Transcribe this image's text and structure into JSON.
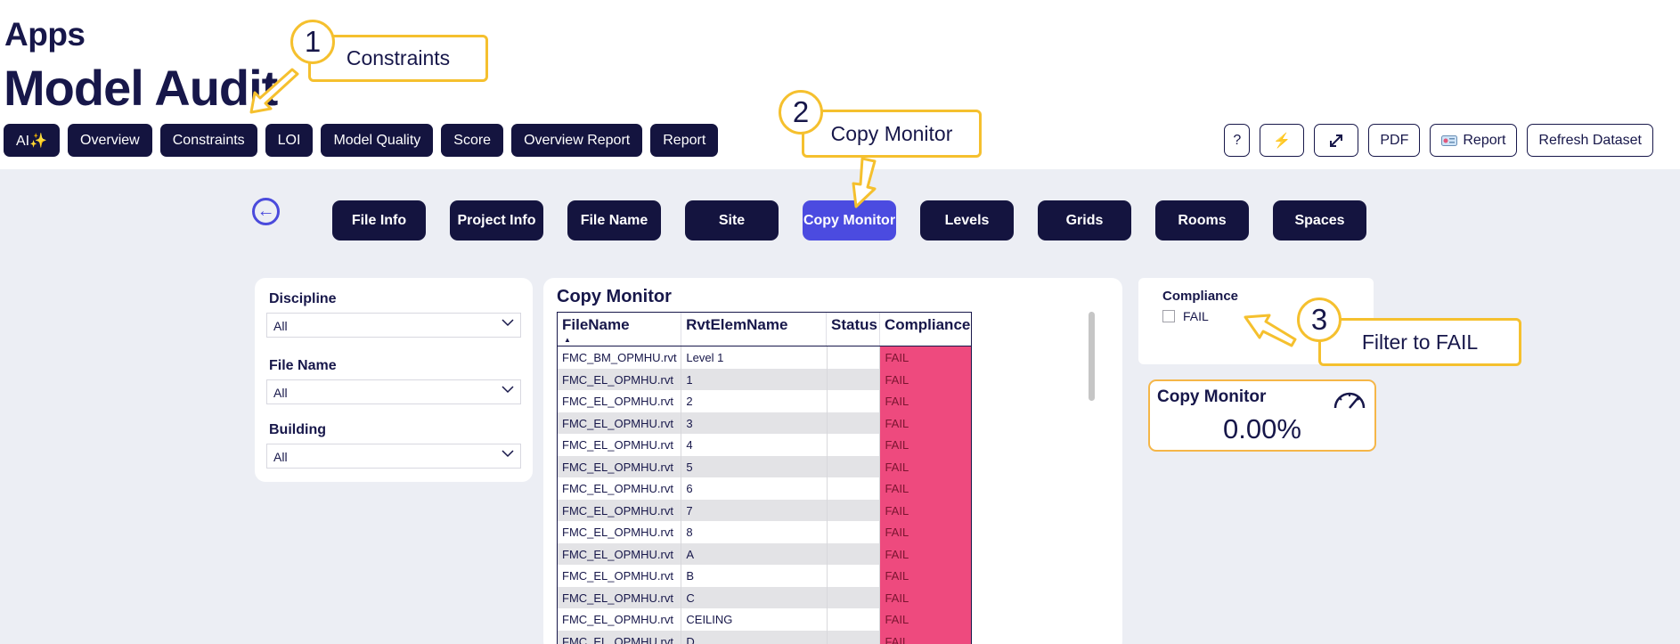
{
  "header": {
    "apps_label": "Apps",
    "page_title": "Model Audit"
  },
  "nav": {
    "items": [
      "AI✨",
      "Overview",
      "Constraints",
      "LOI",
      "Model Quality",
      "Score",
      "Overview Report",
      "Report"
    ]
  },
  "toolbar": {
    "help_label": "?",
    "bolt_icon": "lightning-icon",
    "expand_icon": "expand-icon",
    "pdf_label": "PDF",
    "report_label": "Report",
    "report_icon": "report-card-icon",
    "refresh_label": "Refresh Dataset"
  },
  "sub_nav": {
    "items": [
      "File Info",
      "Project Info",
      "File Name",
      "Site",
      "Copy Monitor",
      "Levels",
      "Grids",
      "Rooms",
      "Spaces"
    ],
    "active": "Copy Monitor"
  },
  "filters": {
    "discipline": {
      "label": "Discipline",
      "value": "All"
    },
    "file_name": {
      "label": "File Name",
      "value": "All"
    },
    "building": {
      "label": "Building",
      "value": "All"
    }
  },
  "table": {
    "title": "Copy Monitor",
    "columns": [
      "FileName",
      "RvtElemName",
      "Status",
      "Compliance"
    ],
    "rows": [
      [
        "FMC_BM_OPMHU.rvt",
        "Level 1",
        "",
        "FAIL"
      ],
      [
        "FMC_EL_OPMHU.rvt",
        "1",
        "",
        "FAIL"
      ],
      [
        "FMC_EL_OPMHU.rvt",
        "2",
        "",
        "FAIL"
      ],
      [
        "FMC_EL_OPMHU.rvt",
        "3",
        "",
        "FAIL"
      ],
      [
        "FMC_EL_OPMHU.rvt",
        "4",
        "",
        "FAIL"
      ],
      [
        "FMC_EL_OPMHU.rvt",
        "5",
        "",
        "FAIL"
      ],
      [
        "FMC_EL_OPMHU.rvt",
        "6",
        "",
        "FAIL"
      ],
      [
        "FMC_EL_OPMHU.rvt",
        "7",
        "",
        "FAIL"
      ],
      [
        "FMC_EL_OPMHU.rvt",
        "8",
        "",
        "FAIL"
      ],
      [
        "FMC_EL_OPMHU.rvt",
        "A",
        "",
        "FAIL"
      ],
      [
        "FMC_EL_OPMHU.rvt",
        "B",
        "",
        "FAIL"
      ],
      [
        "FMC_EL_OPMHU.rvt",
        "C",
        "",
        "FAIL"
      ],
      [
        "FMC_EL_OPMHU.rvt",
        "CEILING",
        "",
        "FAIL"
      ],
      [
        "FMC_EL_OPMHU.rvt",
        "D",
        "",
        "FAIL"
      ]
    ]
  },
  "compliance_slicer": {
    "label": "Compliance",
    "option": "FAIL"
  },
  "kpi": {
    "title": "Copy Monitor",
    "value": "0.00%",
    "icon": "gauge-icon"
  },
  "callouts": [
    {
      "number": "1",
      "text": "Constraints"
    },
    {
      "number": "2",
      "text": "Copy Monitor"
    },
    {
      "number": "3",
      "text": "Filter to FAIL"
    }
  ],
  "colors": {
    "navy": "#14143f",
    "accent": "#4b4be0",
    "fail": "#ee4a7e",
    "callout": "#f5c02e",
    "canvas": "#eceef4"
  }
}
